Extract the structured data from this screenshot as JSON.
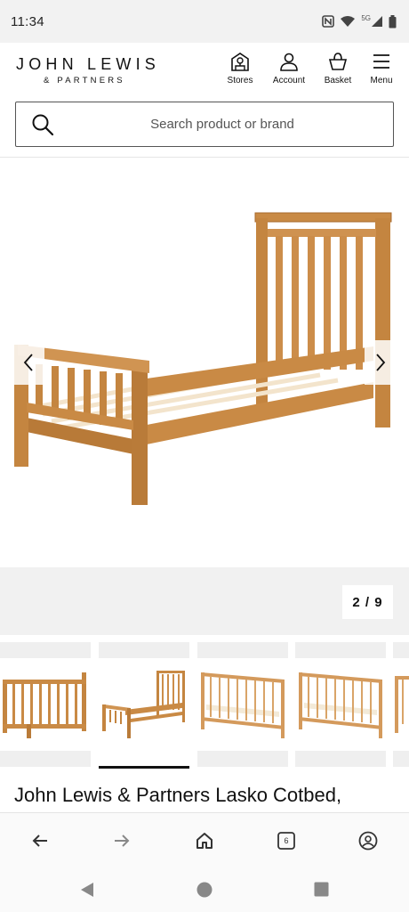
{
  "status_bar": {
    "time": "11:34",
    "network": "5G",
    "icons": [
      "nfc-icon",
      "wifi-icon",
      "signal-icon",
      "battery-icon"
    ]
  },
  "header": {
    "logo_main": "JOHN LEWIS",
    "logo_sub": "& PARTNERS",
    "nav": [
      {
        "label": "Stores",
        "icon": "store-icon"
      },
      {
        "label": "Account",
        "icon": "account-icon"
      },
      {
        "label": "Basket",
        "icon": "basket-icon"
      },
      {
        "label": "Menu",
        "icon": "menu-icon"
      }
    ]
  },
  "search": {
    "placeholder": "Search product or brand"
  },
  "gallery": {
    "counter": "2 / 9",
    "current": 2,
    "total": 9,
    "prev_icon": "chevron-left-icon",
    "next_icon": "chevron-right-icon"
  },
  "thumbnails": [
    {
      "name": "cotbed-side-view",
      "active": false
    },
    {
      "name": "toddler-bed-view",
      "active": true
    },
    {
      "name": "cotbed-with-mattress",
      "active": false
    },
    {
      "name": "cotbed-with-mattress-2",
      "active": false
    },
    {
      "name": "cotbed-partial",
      "active": false
    }
  ],
  "product": {
    "title": "John Lewis & Partners Lasko Cotbed,"
  },
  "browser_bar": {
    "tab_count": "6",
    "icons": [
      "back-arrow-icon",
      "forward-arrow-icon",
      "home-icon",
      "tabs-icon",
      "profile-icon"
    ]
  },
  "colors": {
    "wood": "#c98a45",
    "wood_dark": "#a86a2c",
    "slat": "#f4dfc0",
    "strip": "#f1f1f1"
  }
}
